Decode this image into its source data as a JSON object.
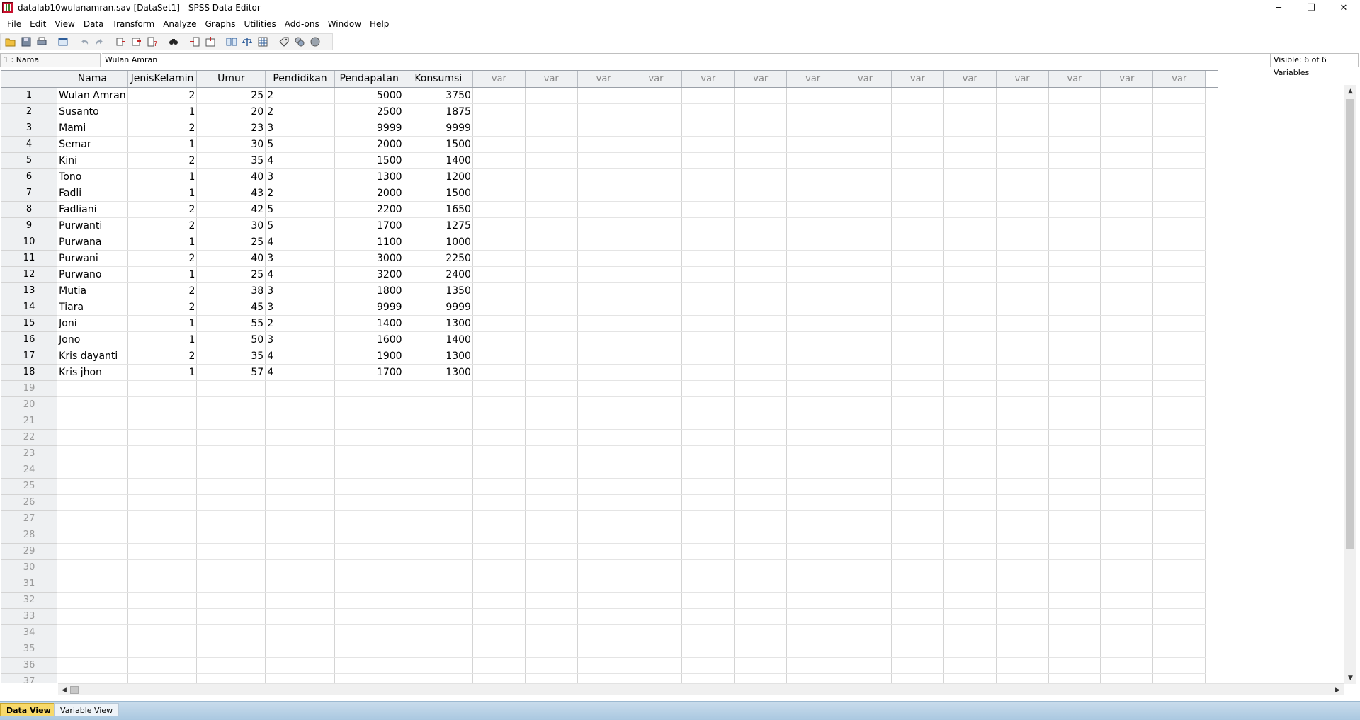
{
  "window": {
    "title": "datalab10wulanamran.sav [DataSet1] - SPSS Data Editor",
    "controls": {
      "minimize": "─",
      "restore": "❐",
      "close": "✕"
    }
  },
  "menu": [
    "File",
    "Edit",
    "View",
    "Data",
    "Transform",
    "Analyze",
    "Graphs",
    "Utilities",
    "Add-ons",
    "Window",
    "Help"
  ],
  "toolbar": {
    "icons": [
      "open-icon",
      "save-icon",
      "print-icon",
      "dialog-recall-icon",
      "undo-icon",
      "redo-icon",
      "go-to-case-icon",
      "insert-variable-icon",
      "variables-icon",
      "find-icon",
      "insert-cases-icon",
      "insert-variable-2-icon",
      "split-file-icon",
      "weight-cases-icon",
      "select-cases-icon",
      "value-labels-icon",
      "use-variable-sets-icon",
      "show-all-variables-icon"
    ]
  },
  "cellbar": {
    "cell_ref": "1 : Nama",
    "cell_value": "Wulan Amran",
    "visible_info": "Visible: 6 of 6 Variables"
  },
  "grid": {
    "columns": [
      {
        "name": "Nama",
        "align": "str"
      },
      {
        "name": "JenisKelamin",
        "align": "num"
      },
      {
        "name": "Umur",
        "align": "num"
      },
      {
        "name": "Pendidikan",
        "align": "cat"
      },
      {
        "name": "Pendapatan",
        "align": "num"
      },
      {
        "name": "Konsumsi",
        "align": "num"
      }
    ],
    "empty_var_label": "var",
    "empty_var_count": 14,
    "rows": [
      [
        "Wulan Amran",
        "2",
        "25",
        "2",
        "5000",
        "3750"
      ],
      [
        "Susanto",
        "1",
        "20",
        "2",
        "2500",
        "1875"
      ],
      [
        "Mami",
        "2",
        "23",
        "3",
        "9999",
        "9999"
      ],
      [
        "Semar",
        "1",
        "30",
        "5",
        "2000",
        "1500"
      ],
      [
        "Kini",
        "2",
        "35",
        "4",
        "1500",
        "1400"
      ],
      [
        "Tono",
        "1",
        "40",
        "3",
        "1300",
        "1200"
      ],
      [
        "Fadli",
        "1",
        "43",
        "2",
        "2000",
        "1500"
      ],
      [
        "Fadliani",
        "2",
        "42",
        "5",
        "2200",
        "1650"
      ],
      [
        "Purwanti",
        "2",
        "30",
        "5",
        "1700",
        "1275"
      ],
      [
        "Purwana",
        "1",
        "25",
        "4",
        "1100",
        "1000"
      ],
      [
        "Purwani",
        "2",
        "40",
        "3",
        "3000",
        "2250"
      ],
      [
        "Purwano",
        "1",
        "25",
        "4",
        "3200",
        "2400"
      ],
      [
        "Mutia",
        "2",
        "38",
        "3",
        "1800",
        "1350"
      ],
      [
        "Tiara",
        "2",
        "45",
        "3",
        "9999",
        "9999"
      ],
      [
        "Joni",
        "1",
        "55",
        "2",
        "1400",
        "1300"
      ],
      [
        "Jono",
        "1",
        "50",
        "3",
        "1600",
        "1400"
      ],
      [
        "Kris dayanti",
        "2",
        "35",
        "4",
        "1900",
        "1300"
      ],
      [
        "Kris jhon",
        "1",
        "57",
        "4",
        "1700",
        "1300"
      ]
    ],
    "total_row_numbers": 37
  },
  "scrollbars": {
    "up": "▲",
    "down": "▼",
    "left": "◀",
    "right": "▶"
  },
  "tabs": {
    "data_view": "Data View",
    "variable_view": "Variable View",
    "active": "Data View"
  }
}
